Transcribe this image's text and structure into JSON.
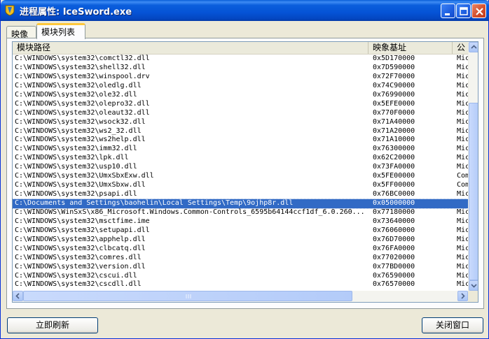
{
  "window": {
    "title": "进程属性: IceSword.exe",
    "icon": "icesword-app-icon",
    "controls": [
      "minimize-icon",
      "maximize-icon",
      "close-icon"
    ]
  },
  "tabs": [
    {
      "label": "映像",
      "active": false
    },
    {
      "label": "模块列表",
      "active": true
    }
  ],
  "list": {
    "columns": [
      "模块路径",
      "映象基址",
      "公"
    ],
    "rows": [
      {
        "path": "C:\\WINDOWS\\system32\\comctl32.dll",
        "base": "0x5D170000",
        "company": "Mic"
      },
      {
        "path": "C:\\WINDOWS\\system32\\shell32.dll",
        "base": "0x7D590000",
        "company": "Mic"
      },
      {
        "path": "C:\\WINDOWS\\system32\\winspool.drv",
        "base": "0x72F70000",
        "company": "Mic"
      },
      {
        "path": "C:\\WINDOWS\\system32\\oledlg.dll",
        "base": "0x74C90000",
        "company": "Mic"
      },
      {
        "path": "C:\\WINDOWS\\system32\\ole32.dll",
        "base": "0x76990000",
        "company": "Mic"
      },
      {
        "path": "C:\\WINDOWS\\system32\\olepro32.dll",
        "base": "0x5EFE0000",
        "company": "Mic"
      },
      {
        "path": "C:\\WINDOWS\\system32\\oleaut32.dll",
        "base": "0x770F0000",
        "company": "Mic"
      },
      {
        "path": "C:\\WINDOWS\\system32\\wsock32.dll",
        "base": "0x71A40000",
        "company": "Mic"
      },
      {
        "path": "C:\\WINDOWS\\system32\\ws2_32.dll",
        "base": "0x71A20000",
        "company": "Mic"
      },
      {
        "path": "C:\\WINDOWS\\system32\\ws2help.dll",
        "base": "0x71A10000",
        "company": "Mic"
      },
      {
        "path": "C:\\WINDOWS\\system32\\imm32.dll",
        "base": "0x76300000",
        "company": "Mic"
      },
      {
        "path": "C:\\WINDOWS\\system32\\lpk.dll",
        "base": "0x62C20000",
        "company": "Mic"
      },
      {
        "path": "C:\\WINDOWS\\system32\\usp10.dll",
        "base": "0x73FA0000",
        "company": "Mic"
      },
      {
        "path": "C:\\WINDOWS\\system32\\UmxSbxExw.dll",
        "base": "0x5FE00000",
        "company": "Com"
      },
      {
        "path": "C:\\WINDOWS\\system32\\UmxSbxw.dll",
        "base": "0x5FF00000",
        "company": "Com"
      },
      {
        "path": "C:\\WINDOWS\\system32\\psapi.dll",
        "base": "0x76BC0000",
        "company": "Mic"
      },
      {
        "path": "C:\\Documents and Settings\\baohelin\\Local Settings\\Temp\\9ojhp8r.dll",
        "base": "0x05000000",
        "company": "",
        "selected": true
      },
      {
        "path": "C:\\WINDOWS\\WinSxS\\x86_Microsoft.Windows.Common-Controls_6595b64144ccf1df_6.0.260...",
        "base": "0x77180000",
        "company": "Mic"
      },
      {
        "path": "C:\\WINDOWS\\system32\\msctfime.ime",
        "base": "0x73640000",
        "company": "Mic"
      },
      {
        "path": "C:\\WINDOWS\\system32\\setupapi.dll",
        "base": "0x76060000",
        "company": "Mic"
      },
      {
        "path": "C:\\WINDOWS\\system32\\apphelp.dll",
        "base": "0x76D70000",
        "company": "Mic"
      },
      {
        "path": "C:\\WINDOWS\\system32\\clbcatq.dll",
        "base": "0x76FA0000",
        "company": "Mic"
      },
      {
        "path": "C:\\WINDOWS\\system32\\comres.dll",
        "base": "0x77020000",
        "company": "Mic"
      },
      {
        "path": "C:\\WINDOWS\\system32\\version.dll",
        "base": "0x77BD0000",
        "company": "Mic"
      },
      {
        "path": "C:\\WINDOWS\\system32\\cscui.dll",
        "base": "0x76590000",
        "company": "Mic"
      },
      {
        "path": "C:\\WINDOWS\\system32\\cscdll.dll",
        "base": "0x76570000",
        "company": "Mic"
      }
    ]
  },
  "buttons": {
    "refresh": "立即刷新",
    "close": "关闭窗口"
  },
  "colors": {
    "titlebar": "#0553d6",
    "selection": "#316ac5",
    "active_tab_accent": "#ffc83c"
  }
}
